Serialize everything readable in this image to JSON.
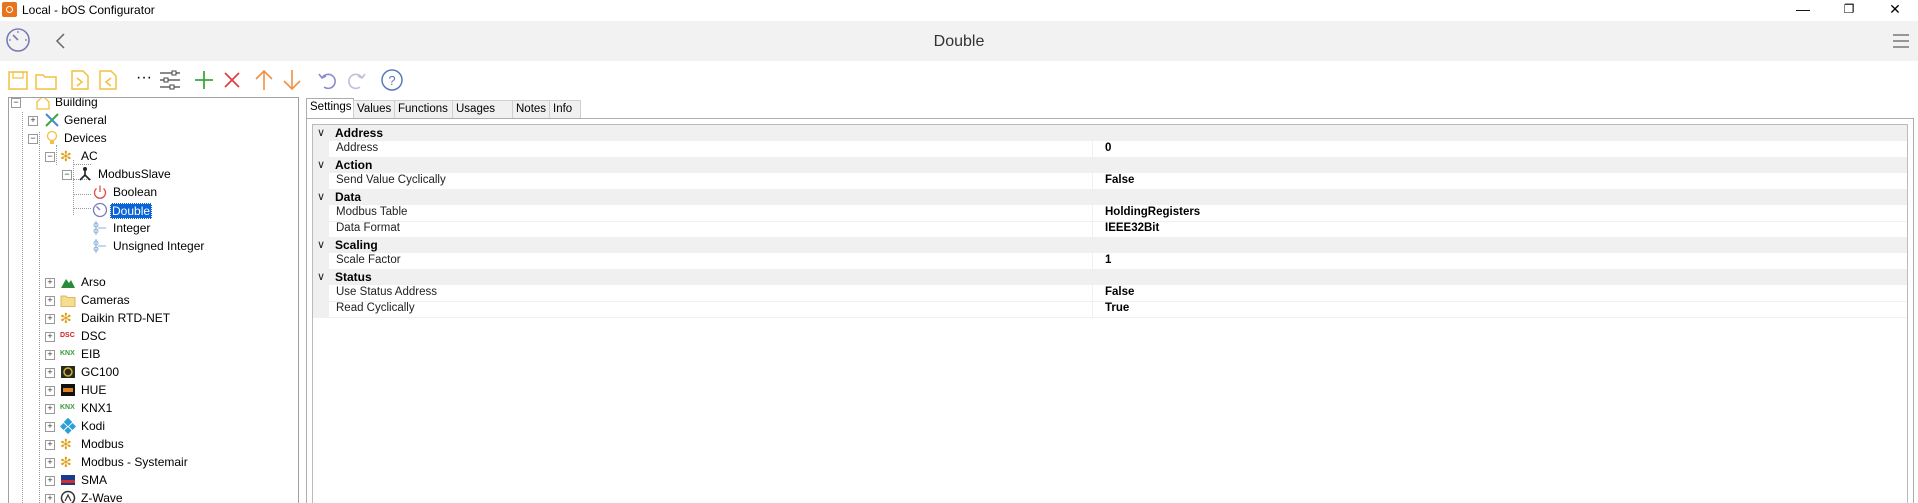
{
  "window": {
    "title": "Local - bOS Configurator",
    "controls": [
      "minimize-icon",
      "restore-icon",
      "close-icon"
    ],
    "minimize": "—",
    "restore": "❐",
    "close": "✕"
  },
  "header": {
    "title": "Double"
  },
  "toolbar": {
    "buttons": [
      "save-icon",
      "open-folder-icon",
      "export-icon",
      "import-icon",
      "more-icon",
      "properties-icon",
      "add-icon",
      "delete-icon",
      "move-up-icon",
      "move-down-icon",
      "undo-icon",
      "redo-icon",
      "help-icon"
    ],
    "more_label": "···"
  },
  "tree": {
    "root": "Building",
    "general": "General",
    "devices": "Devices",
    "ac": "AC",
    "modbus_slave": "ModbusSlave",
    "boolean": "Boolean",
    "double": "Double",
    "integer": "Integer",
    "unsigned_integer": "Unsigned Integer",
    "arso": "Arso",
    "cameras": "Cameras",
    "daikin": "Daikin RTD-NET",
    "dsc": "DSC",
    "eib": "EIB",
    "gc100": "GC100",
    "hue": "HUE",
    "knx1": "KNX1",
    "kodi": "Kodi",
    "modbus": "Modbus",
    "modbus_systemair": "Modbus - Systemair",
    "sma": "SMA",
    "zwave": "Z-Wave",
    "selected": "Double"
  },
  "tabs": [
    "Settings",
    "Values",
    "Functions",
    "Usages (0)",
    "Notes",
    "Info"
  ],
  "active_tab": "Settings",
  "properties": {
    "address_cat": "Address",
    "address_name": "Address",
    "address_val": "0",
    "action_cat": "Action",
    "send_name": "Send Value Cyclically",
    "send_val": "False",
    "data_cat": "Data",
    "table_name": "Modbus Table",
    "table_val": "HoldingRegisters",
    "format_name": "Data Format",
    "format_val": "IEEE32Bit",
    "scaling_cat": "Scaling",
    "scale_name": "Scale Factor",
    "scale_val": "1",
    "status_cat": "Status",
    "usestatus_name": "Use Status Address",
    "usestatus_val": "False",
    "readcyc_name": "Read Cyclically",
    "readcyc_val": "True"
  },
  "colors": {
    "accent": "#0a64d6",
    "toolbar_yellow": "#f0c040",
    "add_green": "#3aa83a",
    "delete_red": "#e04040",
    "arrow_orange": "#f09040"
  }
}
